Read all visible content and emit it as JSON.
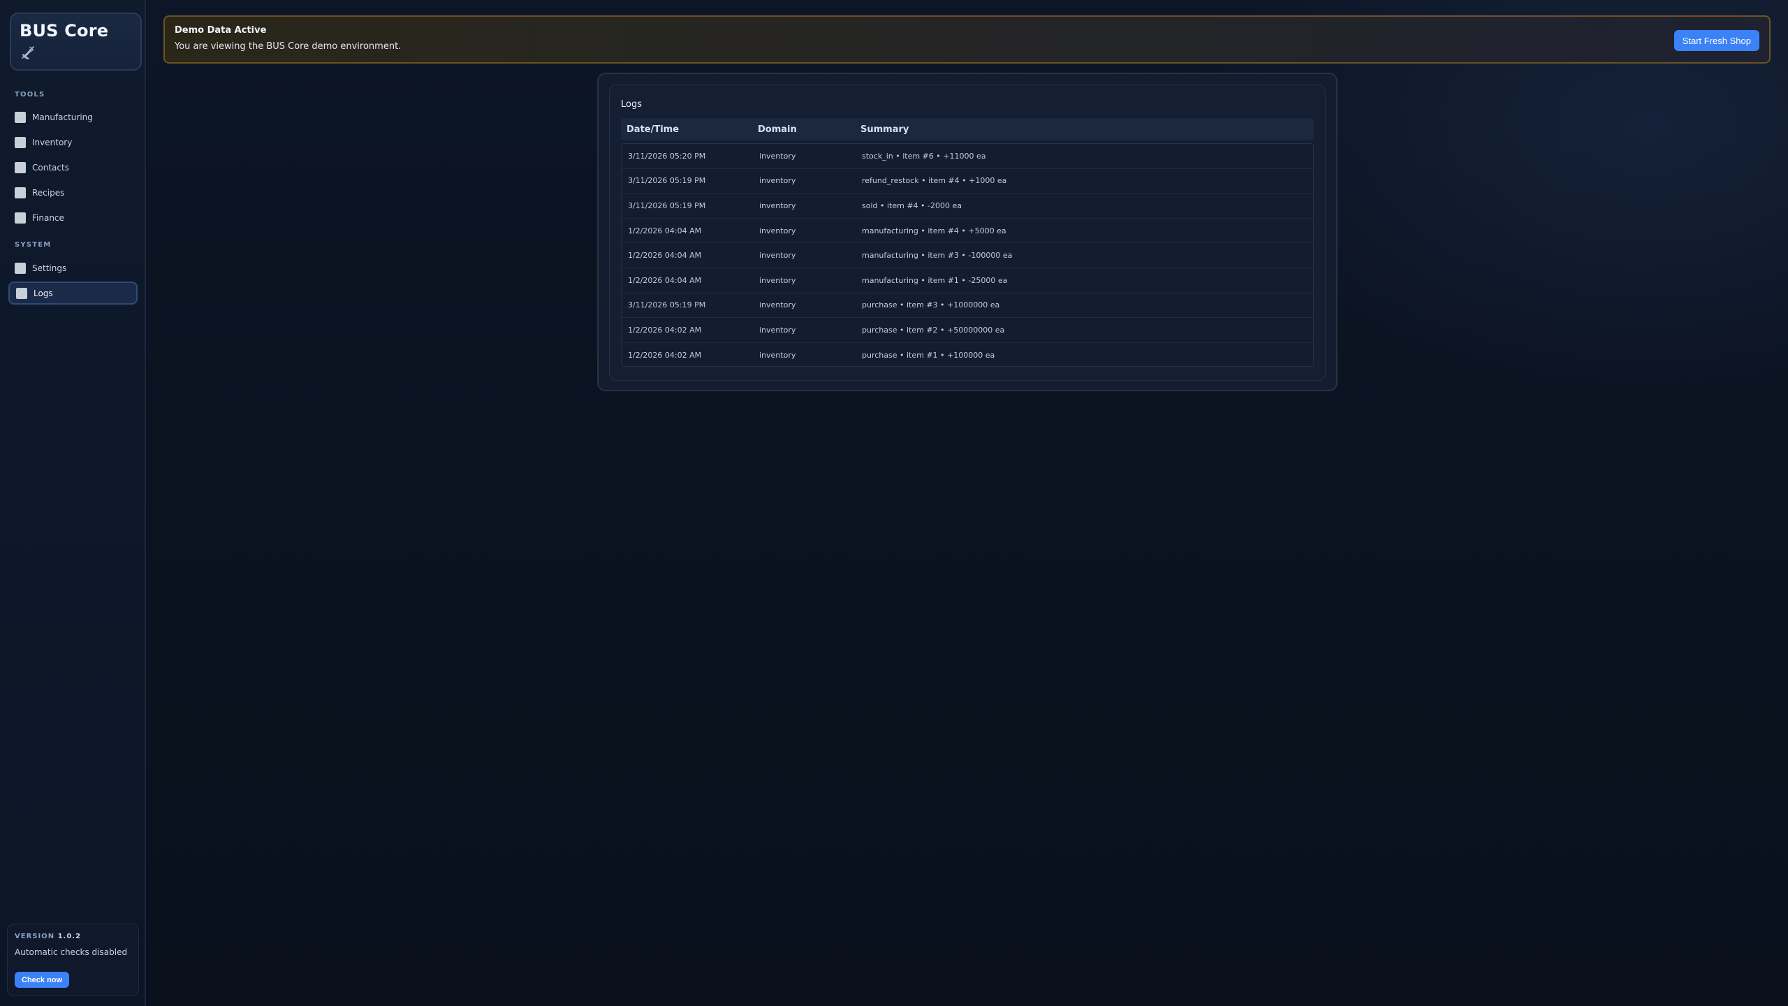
{
  "sidebar": {
    "brand": "BUS Core",
    "sections": [
      {
        "label": "TOOLS",
        "items": [
          "Manufacturing",
          "Inventory",
          "Contacts",
          "Recipes",
          "Finance"
        ]
      },
      {
        "label": "SYSTEM",
        "items": [
          "Settings",
          "Logs"
        ]
      }
    ],
    "active_item": "Logs",
    "version": {
      "label": "VERSION",
      "number": "1.0.2",
      "status": "Automatic checks disabled",
      "check_button": "Check now"
    }
  },
  "banner": {
    "title": "Demo Data Active",
    "text": "You are viewing the BUS Core demo environment.",
    "button": "Start Fresh Shop"
  },
  "logs": {
    "title": "Logs",
    "columns": [
      "Date/Time",
      "Domain",
      "Summary"
    ],
    "rows": [
      [
        "3/11/2026 05:20 PM",
        "inventory",
        "stock_in • item #6 • +11000 ea"
      ],
      [
        "3/11/2026 05:19 PM",
        "inventory",
        "refund_restock • item #4 • +1000 ea"
      ],
      [
        "3/11/2026 05:19 PM",
        "inventory",
        "sold • item #4 • -2000 ea"
      ],
      [
        "1/2/2026 04:04 AM",
        "inventory",
        "manufacturing • item #4 • +5000 ea"
      ],
      [
        "1/2/2026 04:04 AM",
        "inventory",
        "manufacturing • item #3 • -100000 ea"
      ],
      [
        "1/2/2026 04:04 AM",
        "inventory",
        "manufacturing • item #1 • -25000 ea"
      ],
      [
        "3/11/2026 05:19 PM",
        "inventory",
        "purchase • item #3 • +1000000 ea"
      ],
      [
        "1/2/2026 04:02 AM",
        "inventory",
        "purchase • item #2 • +50000000 ea"
      ],
      [
        "1/2/2026 04:02 AM",
        "inventory",
        "purchase • item #1 • +100000 ea"
      ]
    ]
  },
  "colors": {
    "accent": "#3b82f6",
    "background": "#0b1220",
    "banner_border": "#6b5322"
  }
}
